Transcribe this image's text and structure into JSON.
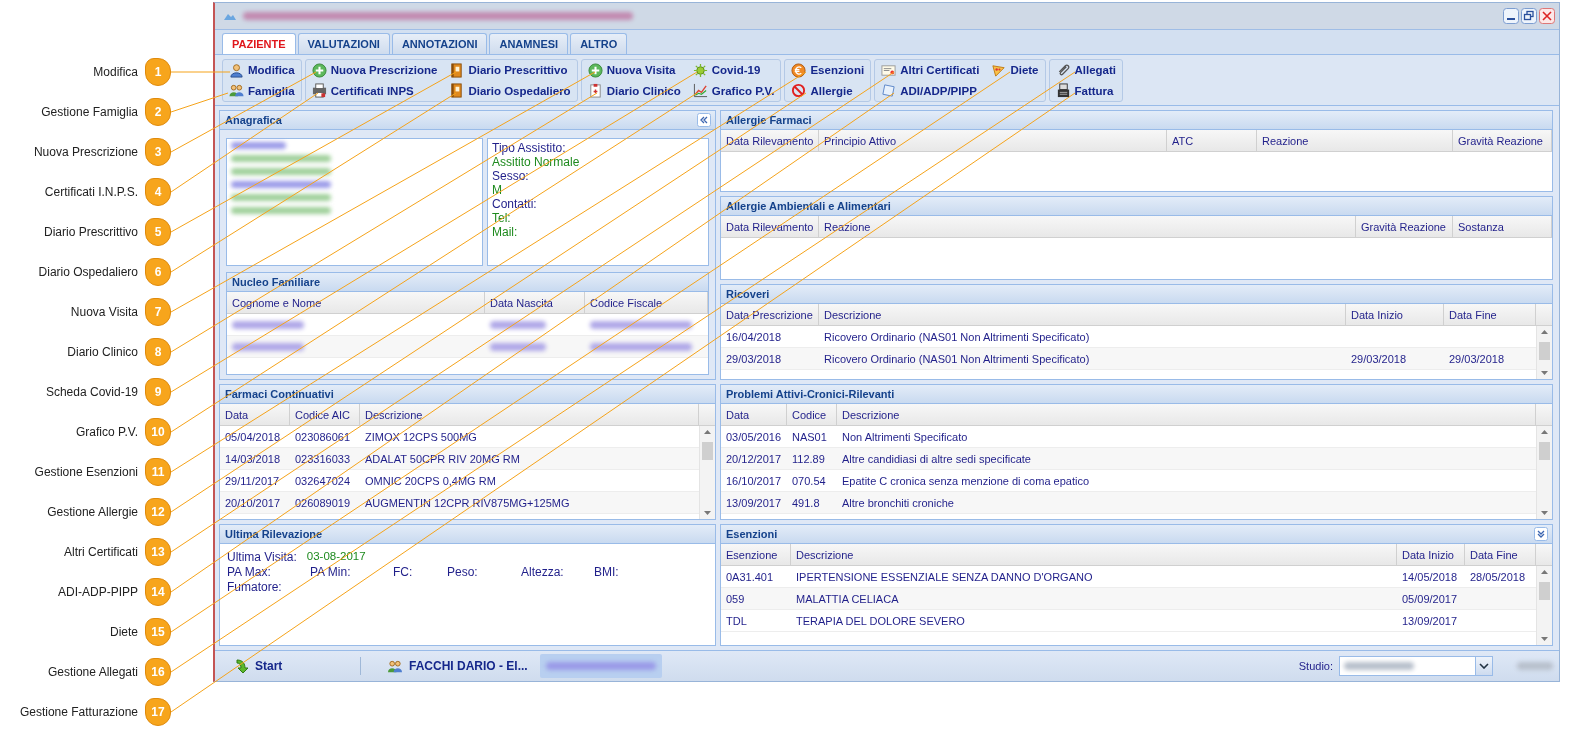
{
  "window": {
    "tabs": [
      {
        "label": "PAZIENTE",
        "selected": true
      },
      {
        "label": "VALUTAZIONI",
        "selected": false
      },
      {
        "label": "ANNOTAZIONI",
        "selected": false
      },
      {
        "label": "ANAMNESI",
        "selected": false
      },
      {
        "label": "ALTRO",
        "selected": false
      }
    ]
  },
  "toolbar": [
    {
      "buttons": [
        "Modifica",
        "Famiglia"
      ]
    },
    {
      "buttons": [
        "Nuova Prescrizione",
        "Certificati INPS",
        "Diario Prescrittivo",
        "Diario Ospedaliero"
      ]
    },
    {
      "buttons": [
        "Nuova Visita",
        "Diario Clinico",
        "Covid-19",
        "Grafico P.V."
      ]
    },
    {
      "buttons": [
        "Esenzioni",
        "Allergie"
      ]
    },
    {
      "buttons": [
        "Altri Certificati",
        "ADI/ADP/PIPP",
        "Diete"
      ]
    },
    {
      "buttons": [
        "Allegati",
        "Fattura"
      ]
    }
  ],
  "anagrafica": {
    "title": "Anagrafica",
    "details": [
      {
        "text": "Tipo Assistito:",
        "kind": "label"
      },
      {
        "text": "Assitito Normale",
        "kind": "value"
      },
      {
        "text": "Sesso:",
        "kind": "label"
      },
      {
        "text": "M",
        "kind": "value"
      },
      {
        "text": "Contatti:",
        "kind": "label"
      },
      {
        "text": "Tel:",
        "kind": "value"
      },
      {
        "text": "Mail:",
        "kind": "value"
      }
    ]
  },
  "nucleo_familiare": {
    "title": "Nucleo Familiare",
    "columns": [
      "Cognome e Nome",
      "Data Nascita",
      "Codice Fiscale"
    ]
  },
  "farmaci_continuativi": {
    "title": "Farmaci Continuativi",
    "columns": [
      "Data",
      "Codice AIC",
      "Descrizione"
    ],
    "rows": [
      [
        "05/04/2018",
        "023086061",
        "ZIMOX 12CPS 500MG"
      ],
      [
        "14/03/2018",
        "023316033",
        "ADALAT 50CPR RIV 20MG RM"
      ],
      [
        "29/11/2017",
        "032647024",
        "OMNIC 20CPS 0,4MG RM"
      ],
      [
        "20/10/2017",
        "026089019",
        "AUGMENTIN 12CPR RIV875MG+125MG"
      ]
    ]
  },
  "ultima_rilevazione": {
    "title": "Ultima Rilevazione",
    "visit_label": "Ultima Visita:",
    "visit_date": "03-08-2017",
    "fields": [
      "PA Max:",
      "PA Min:",
      "FC:",
      "Peso:",
      "Altezza:",
      "BMI:"
    ],
    "smoker_label": "Fumatore:"
  },
  "allergie_farmaci": {
    "title": "Allergie Farmaci",
    "columns": [
      "Data Rilevamento",
      "Principio Attivo",
      "ATC",
      "Reazione",
      "Gravità Reazione"
    ]
  },
  "allergie_ambientali": {
    "title": "Allergie Ambientali e Alimentari",
    "columns": [
      "Data Rilevamento",
      "Reazione",
      "Gravità Reazione",
      "Sostanza"
    ]
  },
  "ricoveri": {
    "title": "Ricoveri",
    "columns": [
      "Data Prescrizione",
      "Descrizione",
      "Data Inizio",
      "Data Fine"
    ],
    "rows": [
      [
        "16/04/2018",
        "Ricovero Ordinario (NAS01 Non Altrimenti Specificato)",
        "",
        ""
      ],
      [
        "29/03/2018",
        "Ricovero Ordinario (NAS01 Non Altrimenti Specificato)",
        "29/03/2018",
        "29/03/2018"
      ]
    ]
  },
  "problemi": {
    "title": "Problemi Attivi-Cronici-Rilevanti",
    "columns": [
      "Data",
      "Codice",
      "Descrizione"
    ],
    "rows": [
      [
        "03/05/2016",
        "NAS01",
        "Non Altrimenti Specificato"
      ],
      [
        "20/12/2017",
        "112.89",
        "Altre candidiasi di altre sedi specificate"
      ],
      [
        "16/10/2017",
        "070.54",
        "Epatite C cronica senza menzione di coma epatico"
      ],
      [
        "13/09/2017",
        "491.8",
        "Altre bronchiti croniche"
      ]
    ]
  },
  "esenzioni": {
    "title": "Esenzioni",
    "columns": [
      "Esenzione",
      "Descrizione",
      "Data Inizio",
      "Data Fine"
    ],
    "rows": [
      [
        "0A31.401",
        "IPERTENSIONE ESSENZIALE SENZA DANNO D'ORGANO",
        "14/05/2018",
        "28/05/2018"
      ],
      [
        "059",
        "MALATTIA CELIACA",
        "05/09/2017",
        ""
      ],
      [
        "TDL",
        "TERAPIA DEL DOLORE SEVERO",
        "13/09/2017",
        ""
      ]
    ]
  },
  "taskbar": {
    "start": "Start",
    "task": "FACCHI DARIO - El...",
    "studio_label": "Studio:"
  },
  "callouts": [
    {
      "number": "1",
      "label": "Modifica"
    },
    {
      "number": "2",
      "label": "Gestione Famiglia"
    },
    {
      "number": "3",
      "label": "Nuova Prescrizione"
    },
    {
      "number": "4",
      "label": "Certificati I.N.P.S."
    },
    {
      "number": "5",
      "label": "Diario Prescrittivo"
    },
    {
      "number": "6",
      "label": "Diario Ospedaliero"
    },
    {
      "number": "7",
      "label": "Nuova Visita"
    },
    {
      "number": "8",
      "label": "Diario Clinico"
    },
    {
      "number": "9",
      "label": "Scheda Covid-19"
    },
    {
      "number": "10",
      "label": "Grafico P.V."
    },
    {
      "number": "11",
      "label": "Gestione Esenzioni"
    },
    {
      "number": "12",
      "label": "Gestione Allergie"
    },
    {
      "number": "13",
      "label": "Altri Certificati"
    },
    {
      "number": "14",
      "label": "ADI-ADP-PIPP"
    },
    {
      "number": "15",
      "label": "Diete"
    },
    {
      "number": "16",
      "label": "Gestione Allegati"
    },
    {
      "number": "17",
      "label": "Gestione Fatturazione"
    }
  ]
}
